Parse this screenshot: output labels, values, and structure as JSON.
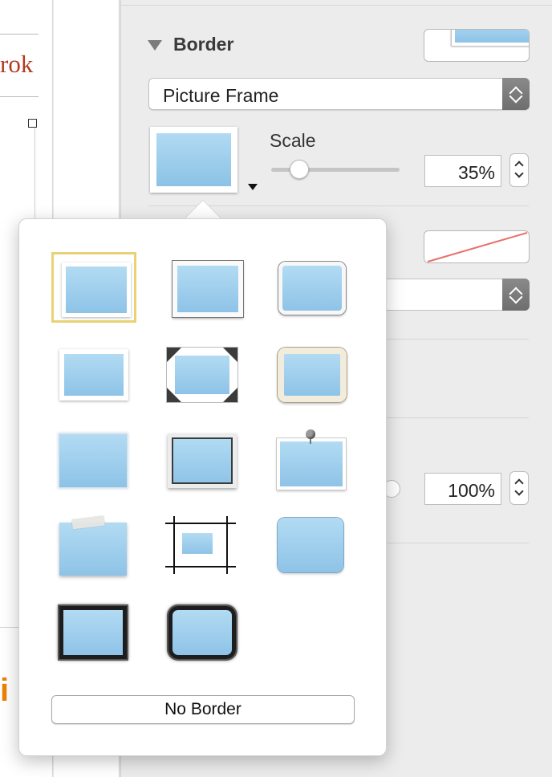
{
  "document": {
    "text_fragment": "rok",
    "orange_fragment": "i"
  },
  "inspector": {
    "section_title": "Border",
    "border_type": {
      "selected": "Picture Frame"
    },
    "scale": {
      "label": "Scale",
      "value": "35%",
      "slider_fraction": 0.22
    },
    "opacity_value": "100%"
  },
  "popover": {
    "frames": [
      {
        "name": "simple-white-frame",
        "selected": true
      },
      {
        "name": "gray-matte-frame",
        "selected": false
      },
      {
        "name": "rounded-gray-frame",
        "selected": false
      },
      {
        "name": "photo-corners-frame",
        "selected": false
      },
      {
        "name": "black-corners-frame",
        "selected": false
      },
      {
        "name": "rounded-cream-frame",
        "selected": false
      },
      {
        "name": "deckled-edge-frame",
        "selected": false
      },
      {
        "name": "dark-inner-frame",
        "selected": false
      },
      {
        "name": "pushpin-frame",
        "selected": false
      },
      {
        "name": "taped-frame",
        "selected": false
      },
      {
        "name": "sketch-lines-frame",
        "selected": false
      },
      {
        "name": "rounded-edge-frame",
        "selected": false
      },
      {
        "name": "charcoal-frame",
        "selected": false
      },
      {
        "name": "rounded-charcoal-frame",
        "selected": false
      }
    ],
    "no_border_label": "No Border"
  },
  "colors": {
    "accent_selection": "#e9d275",
    "picture_blue": "#9fcfee",
    "document_red": "#b43a1e",
    "document_orange": "#e8820a"
  }
}
